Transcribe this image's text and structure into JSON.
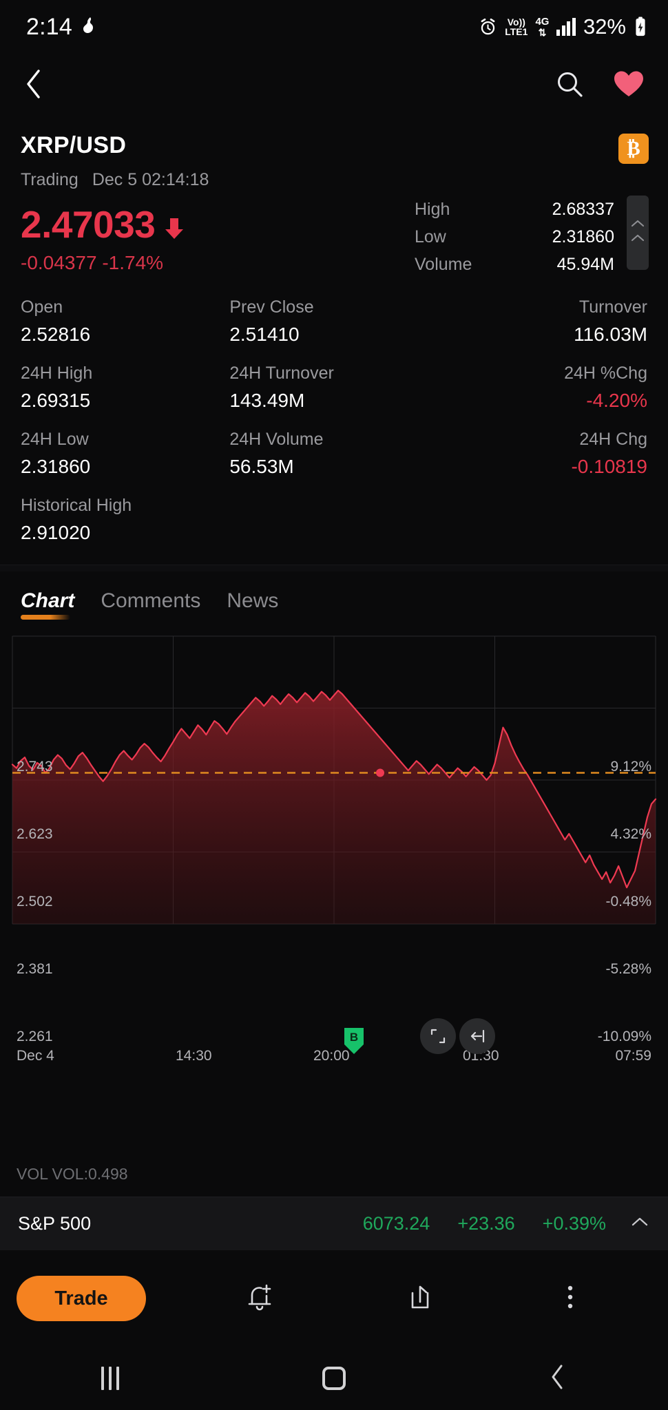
{
  "status_bar": {
    "time": "2:14",
    "battery_percent": "32%",
    "network": "4G",
    "volte_top": "Vo))",
    "volte_bottom": "LTE1",
    "icons": [
      "alarm-icon",
      "volte-icon",
      "4g-icon",
      "signal-bars-icon",
      "battery-charging-icon"
    ]
  },
  "top_nav": {
    "back_icon": "chevron-left-icon",
    "search_icon": "search-icon",
    "favorite_icon": "heart-icon",
    "favorite_color": "#f2607a"
  },
  "symbol": {
    "name": "XRP/USD",
    "status": "Trading",
    "timestamp": "Dec 5 02:14:18",
    "badge": "₿"
  },
  "price": {
    "last": "2.47033",
    "direction": "down",
    "change_abs": "-0.04377",
    "change_pct": "-1.74%",
    "color": "#e8364c"
  },
  "quote_side": [
    {
      "label": "High",
      "value": "2.68337"
    },
    {
      "label": "Low",
      "value": "2.31860"
    },
    {
      "label": "Volume",
      "value": "45.94M"
    }
  ],
  "stats": [
    {
      "label": "Open",
      "value": "2.52816",
      "neg": false
    },
    {
      "label": "Prev Close",
      "value": "2.51410",
      "neg": false
    },
    {
      "label": "Turnover",
      "value": "116.03M",
      "neg": false
    },
    {
      "label": "24H High",
      "value": "2.69315",
      "neg": false
    },
    {
      "label": "24H Turnover",
      "value": "143.49M",
      "neg": false
    },
    {
      "label": "24H %Chg",
      "value": "-4.20%",
      "neg": true
    },
    {
      "label": "24H Low",
      "value": "2.31860",
      "neg": false
    },
    {
      "label": "24H Volume",
      "value": "56.53M",
      "neg": false
    },
    {
      "label": "24H Chg",
      "value": "-0.10819",
      "neg": true
    },
    {
      "label": "Historical High",
      "value": "2.91020",
      "neg": false
    }
  ],
  "tabs": [
    {
      "label": "Chart",
      "active": true
    },
    {
      "label": "Comments",
      "active": false
    },
    {
      "label": "News",
      "active": false
    }
  ],
  "chart_data": {
    "type": "area",
    "title": "",
    "xlabel": "",
    "ylabel": "",
    "ylim": [
      2.261,
      2.743
    ],
    "y_ticks": [
      "2.743",
      "2.623",
      "2.502",
      "2.381",
      "2.261"
    ],
    "y2_ticks": [
      "9.12%",
      "4.32%",
      "-0.48%",
      "-5.28%",
      "-10.09%"
    ],
    "x_ticks": [
      "Dec 4",
      "14:30",
      "20:00",
      "01:30",
      "07:59"
    ],
    "grid": true,
    "line_color": "#ef3a52",
    "fill_color": "rgba(150,32,40,0.45)",
    "prev_close_line": {
      "value": 2.5141,
      "style": "dashed",
      "color": "#e08a20"
    },
    "marker": {
      "label": "B",
      "type": "buy-marker",
      "color": "#17c26a"
    },
    "last_point_color": "#ef3a52",
    "series": [
      {
        "name": "XRP/USD",
        "values": [
          2.528,
          2.522,
          2.534,
          2.54,
          2.526,
          2.519,
          2.531,
          2.526,
          2.514,
          2.522,
          2.536,
          2.544,
          2.538,
          2.527,
          2.52,
          2.53,
          2.542,
          2.548,
          2.539,
          2.528,
          2.518,
          2.508,
          2.5,
          2.509,
          2.52,
          2.533,
          2.544,
          2.551,
          2.543,
          2.536,
          2.545,
          2.556,
          2.563,
          2.557,
          2.548,
          2.54,
          2.533,
          2.543,
          2.555,
          2.566,
          2.578,
          2.588,
          2.58,
          2.572,
          2.583,
          2.594,
          2.587,
          2.578,
          2.59,
          2.601,
          2.596,
          2.588,
          2.579,
          2.59,
          2.6,
          2.608,
          2.616,
          2.624,
          2.632,
          2.64,
          2.634,
          2.626,
          2.634,
          2.643,
          2.637,
          2.629,
          2.638,
          2.646,
          2.64,
          2.632,
          2.64,
          2.648,
          2.642,
          2.634,
          2.642,
          2.65,
          2.644,
          2.636,
          2.644,
          2.652,
          2.646,
          2.638,
          2.63,
          2.622,
          2.614,
          2.606,
          2.598,
          2.59,
          2.582,
          2.574,
          2.566,
          2.558,
          2.55,
          2.542,
          2.534,
          2.526,
          2.518,
          2.526,
          2.534,
          2.528,
          2.52,
          2.512,
          2.52,
          2.528,
          2.522,
          2.514,
          2.506,
          2.514,
          2.522,
          2.516,
          2.508,
          2.516,
          2.524,
          2.518,
          2.51,
          2.502,
          2.51,
          2.53,
          2.56,
          2.59,
          2.578,
          2.56,
          2.545,
          2.532,
          2.52,
          2.51,
          2.498,
          2.486,
          2.474,
          2.462,
          2.45,
          2.438,
          2.426,
          2.414,
          2.402,
          2.412,
          2.4,
          2.388,
          2.376,
          2.364,
          2.376,
          2.36,
          2.348,
          2.336,
          2.348,
          2.33,
          2.342,
          2.358,
          2.34,
          2.322,
          2.336,
          2.35,
          2.38,
          2.41,
          2.44,
          2.462,
          2.47
        ]
      }
    ]
  },
  "chart_controls": {
    "fullscreen_icon": "fullscreen-icon",
    "scroll_latest_icon": "scroll-to-latest-icon"
  },
  "volume_label": "VOL VOL:0.498",
  "index_bar": {
    "name": "S&P 500",
    "value": "6073.24",
    "change": "+23.36",
    "change_pct": "+0.39%",
    "color": "#1fa85c",
    "chevron": "chevron-up-icon"
  },
  "action_bar": {
    "trade_label": "Trade",
    "alert_icon": "bell-plus-icon",
    "share_icon": "share-icon",
    "more_icon": "more-vertical-icon"
  },
  "android_nav": {
    "recents_icon": "recents-icon",
    "home_icon": "home-icon",
    "back_icon": "back-icon"
  }
}
